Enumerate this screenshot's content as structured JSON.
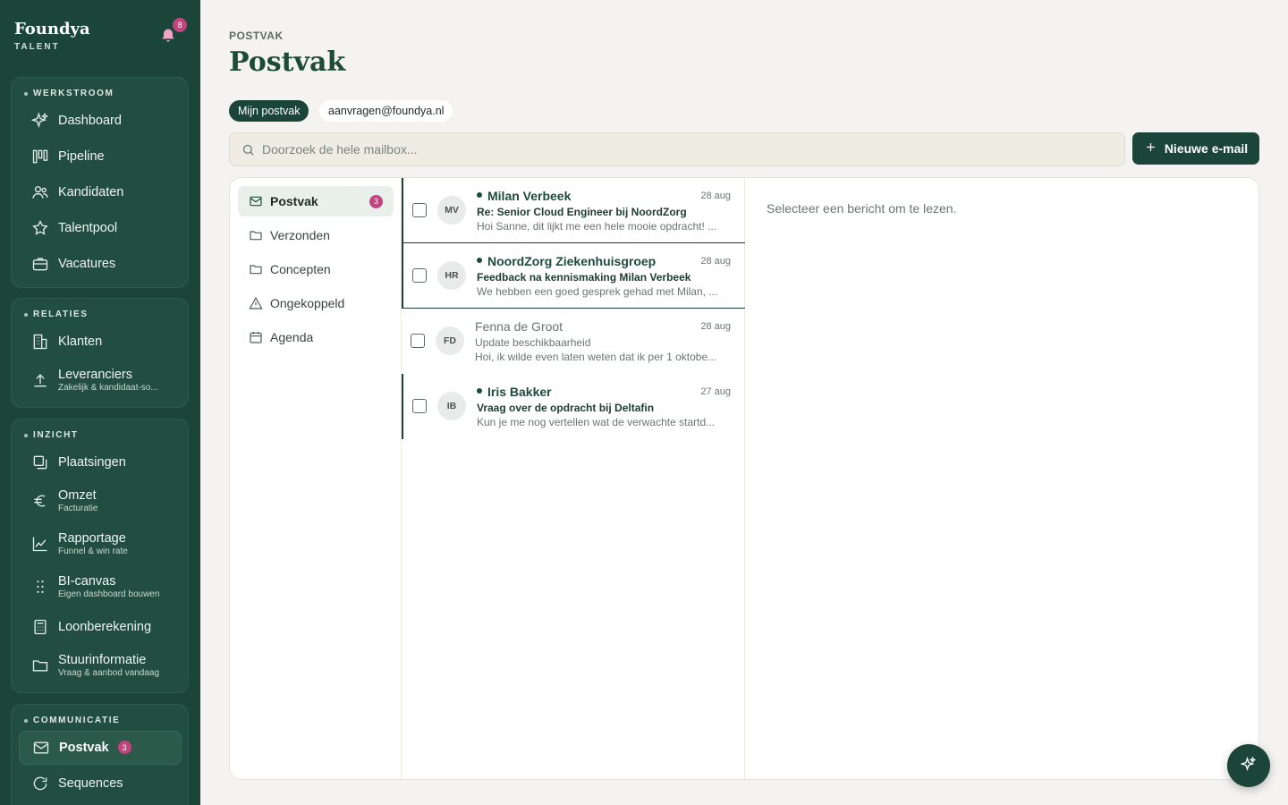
{
  "brand": {
    "name": "Foundya",
    "sub": "TALENT",
    "notification_count": "8"
  },
  "sidebar": {
    "groups": [
      {
        "title": "WERKSTROOM",
        "items": [
          {
            "label": "Dashboard",
            "icon": "sparkles-icon"
          },
          {
            "label": "Pipeline",
            "icon": "pipeline-icon"
          },
          {
            "label": "Kandidaten",
            "icon": "users-icon"
          },
          {
            "label": "Talentpool",
            "icon": "star-icon"
          },
          {
            "label": "Vacatures",
            "icon": "briefcase-icon"
          }
        ]
      },
      {
        "title": "RELATIES",
        "items": [
          {
            "label": "Klanten",
            "icon": "building-icon"
          },
          {
            "label": "Leveranciers",
            "sub": "Zakelijk & kandidaat-so...",
            "icon": "upload-icon"
          }
        ]
      },
      {
        "title": "INZICHT",
        "items": [
          {
            "label": "Plaatsingen",
            "icon": "copy-icon"
          },
          {
            "label": "Omzet",
            "sub": "Facturatie",
            "icon": "euro-icon"
          },
          {
            "label": "Rapportage",
            "sub": "Funnel & win rate",
            "icon": "chart-icon"
          },
          {
            "label": "BI-canvas",
            "sub": "Eigen dashboard bouwen",
            "icon": "grid-dots-icon"
          },
          {
            "label": "Loonberekening",
            "icon": "calculator-icon"
          },
          {
            "label": "Stuurinformatie",
            "sub": "Vraag & aanbod vandaag",
            "icon": "folder-icon"
          }
        ]
      },
      {
        "title": "COMMUNICATIE",
        "items": [
          {
            "label": "Postvak",
            "icon": "mail-icon",
            "badge": "3",
            "active": true
          },
          {
            "label": "Sequences",
            "icon": "refresh-icon"
          }
        ]
      }
    ]
  },
  "page": {
    "breadcrumb": "POSTVAK",
    "title": "Postvak",
    "mailbox_tabs": [
      "Mijn postvak",
      "aanvragen@foundya.nl"
    ],
    "search_placeholder": "Doorzoek de hele mailbox...",
    "new_email_label": "Nieuwe e-mail",
    "reader_empty": "Selecteer een bericht om te lezen."
  },
  "folders": [
    {
      "label": "Postvak",
      "icon": "mail-icon",
      "badge": "3",
      "active": true
    },
    {
      "label": "Verzonden",
      "icon": "folder-icon"
    },
    {
      "label": "Concepten",
      "icon": "folder-icon"
    },
    {
      "label": "Ongekoppeld",
      "icon": "warning-icon"
    },
    {
      "label": "Agenda",
      "icon": "calendar-icon"
    }
  ],
  "messages": [
    {
      "initials": "MV",
      "from": "Milan Verbeek",
      "date": "28 aug",
      "subject": "Re: Senior Cloud Engineer bij NoordZorg",
      "preview": "Hoi Sanne, dit lijkt me een hele mooie opdracht! ...",
      "unread": true
    },
    {
      "initials": "HR",
      "from": "NoordZorg Ziekenhuisgroep",
      "date": "28 aug",
      "subject": "Feedback na kennismaking Milan Verbeek",
      "preview": "We hebben een goed gesprek gehad met Milan, ...",
      "unread": true
    },
    {
      "initials": "FD",
      "from": "Fenna de Groot",
      "date": "28 aug",
      "subject": "Update beschikbaarheid",
      "preview": "Hoi, ik wilde even laten weten dat ik per 1 oktobe...",
      "unread": false
    },
    {
      "initials": "IB",
      "from": "Iris Bakker",
      "date": "27 aug",
      "subject": "Vraag over de opdracht bij Deltafin",
      "preview": "Kun je me nog vertellen wat de verwachte startd...",
      "unread": true
    }
  ]
}
